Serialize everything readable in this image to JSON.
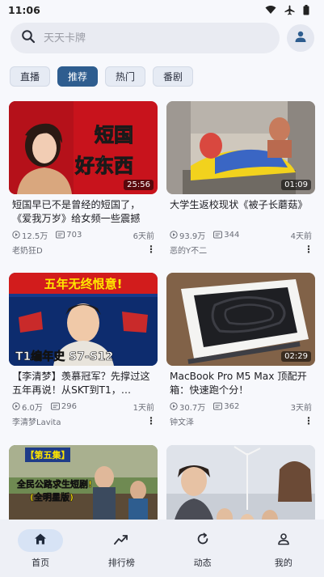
{
  "status_bar": {
    "time": "11:06"
  },
  "search": {
    "placeholder": "天天卡牌"
  },
  "chips": [
    "直播",
    "推荐",
    "热门",
    "番剧"
  ],
  "active_chip": 1,
  "thumb_text": {
    "v1_line1": "短国",
    "v1_line2": "好东西",
    "v3_banner": "五年无终恨意!",
    "v3_bottom": "T1编年史 S7-S12",
    "v5_banner": "【第五集】",
    "v5_sub1": "全民公路求生短剧!",
    "v5_sub2": "(全明星版)"
  },
  "videos": [
    {
      "title": "短国早已不是曾经的短国了，《爱我万岁》给女频一些震撼",
      "duration": "25:56",
      "views": "12.5万",
      "comments": "703",
      "date": "6天前",
      "author": "老奶狂D"
    },
    {
      "title": "大学生返校现状《被子长蘑菇》",
      "duration": "01:09",
      "views": "93.9万",
      "comments": "344",
      "date": "4天前",
      "author": "恶的Y不二"
    },
    {
      "title": "【李清梦】羡慕冠军？先撑过这五年再说！从SKT到T1，…",
      "duration": "",
      "views": "6.0万",
      "comments": "296",
      "date": "1天前",
      "author": "李清梦Lavita"
    },
    {
      "title": "MacBook Pro M5 Max 顶配开箱：快速跑个分！",
      "duration": "02:29",
      "views": "30.7万",
      "comments": "362",
      "date": "3天前",
      "author": "钟文泽"
    },
    {
      "title": "",
      "duration": "",
      "views": "",
      "comments": "",
      "date": "",
      "author": ""
    },
    {
      "title": "",
      "duration": "",
      "views": "",
      "comments": "",
      "date": "",
      "author": ""
    }
  ],
  "nav": [
    "首页",
    "排行榜",
    "动态",
    "我的"
  ],
  "colors": {
    "accent": "#2e5d8f",
    "nav_active_bg": "#d7e3f5",
    "background": "#f7f8fc"
  }
}
